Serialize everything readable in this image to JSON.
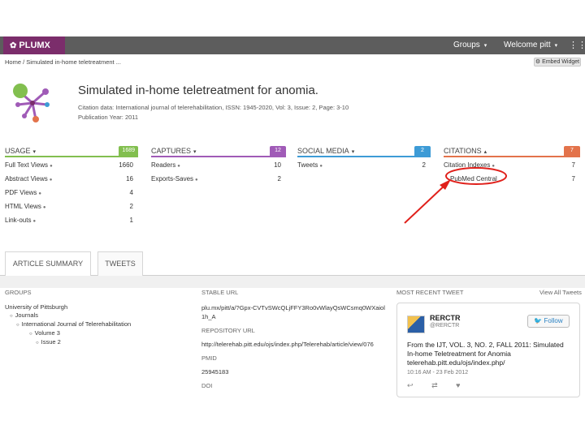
{
  "topbar": {
    "logo": "PLUMX",
    "groups": "Groups",
    "welcome": "Welcome pitt",
    "colors": {
      "bar": "#5d5d5d",
      "logo_bg": "#7b2d6b"
    }
  },
  "breadcrumb": "Home / Simulated in-home teletreatment ...",
  "embed_widget": "Embed Widget",
  "article": {
    "title": "Simulated in-home teletreatment for anomia.",
    "citation": "Citation data: International journal of telerehabilitation, ISSN: 1945-2020, Vol: 3, Issue: 2, Page: 3-10",
    "pub_year": "Publication Year: 2011"
  },
  "metrics": {
    "usage": {
      "label": "USAGE",
      "count": "1689",
      "color": "#82bf4f",
      "rows": [
        {
          "label": "Full Text Views",
          "value": "1660"
        },
        {
          "label": "Abstract Views",
          "value": "16"
        },
        {
          "label": "PDF Views",
          "value": "4"
        },
        {
          "label": "HTML Views",
          "value": "2"
        },
        {
          "label": "Link-outs",
          "value": "1"
        }
      ]
    },
    "captures": {
      "label": "CAPTURES",
      "count": "12",
      "color": "#a05bb7",
      "rows": [
        {
          "label": "Readers",
          "value": "10"
        },
        {
          "label": "Exports-Saves",
          "value": "2"
        }
      ]
    },
    "social": {
      "label": "SOCIAL MEDIA",
      "count": "2",
      "color": "#3d9bd6",
      "rows": [
        {
          "label": "Tweets",
          "value": "2"
        }
      ]
    },
    "citations": {
      "label": "CITATIONS",
      "count": "7",
      "color": "#e3734b",
      "rows": [
        {
          "label": "Citation Indexes",
          "value": "7"
        },
        {
          "label": "PubMed Central",
          "value": "7"
        }
      ]
    }
  },
  "tabs": [
    "ARTICLE SUMMARY",
    "TWEETS"
  ],
  "groups": {
    "heading": "GROUPS",
    "tree": [
      "University of Pittsburgh",
      "Journals",
      "International Journal of Telerehabilitation",
      "Volume 3",
      "Issue 2"
    ]
  },
  "stable": {
    "heading": "STABLE URL",
    "url": "plu.mx/pitt/a/?Gpx-CVTvSWcQLjFFY3Ro0vWlayQsWCsmq0WXaiol1h_A",
    "repo_label": "REPOSITORY URL",
    "repo_url": "http://telerehab.pitt.edu/ojs/index.php/Telerehab/article/view/076",
    "pmid_label": "PMID",
    "pmid": "25945183",
    "doi_label": "DOI"
  },
  "recent": {
    "heading": "MOST RECENT TWEET",
    "view_all": "View All Tweets",
    "tweet": {
      "name": "RERCTR",
      "handle": "@RERCTR",
      "follow": "Follow",
      "text": "From the IJT, VOL. 3, NO. 2, FALL 2011: Simulated In-home Teletreatment for Anomia telerehab.pitt.edu/ojs/index.php/",
      "date": "10:16 AM - 23 Feb 2012"
    }
  },
  "annotation_color": "#e0201b"
}
